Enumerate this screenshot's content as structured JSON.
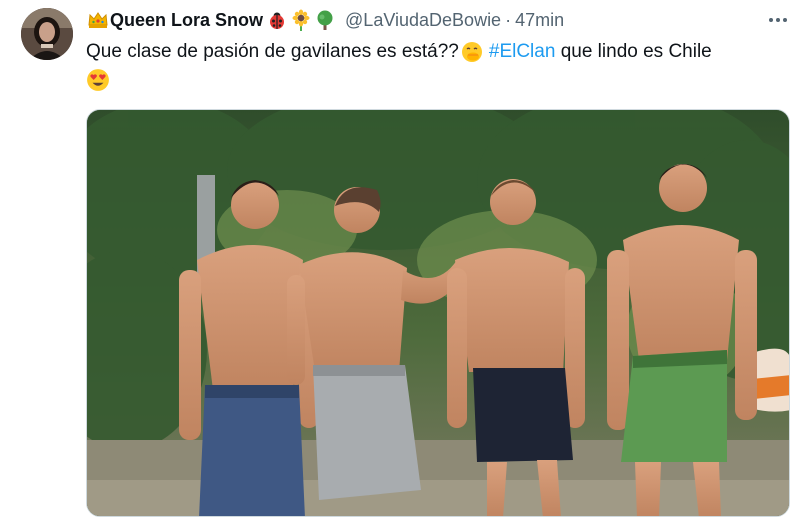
{
  "tweet": {
    "display_name": "Queen Lora Snow",
    "name_emojis_before": [
      "crown-emoji"
    ],
    "name_emojis_after": [
      "ladybug-emoji",
      "sunflower-emoji",
      "tree-emoji"
    ],
    "handle": "@LaViudaDeBowie",
    "separator": "·",
    "time": "47min",
    "more_icon": "ellipsis-icon",
    "text_before": "Que clase de pasión de gavilanes es está??",
    "emoji_mid": "hand-over-mouth-emoji",
    "hashtag": "#ElClan",
    "text_after": " que lindo es Chile",
    "emoji_end": "heart-eyes-emoji"
  },
  "media": {
    "kind": "photo",
    "description_icon": "photo-of-four-men-icon"
  },
  "colors": {
    "text": "#0f1419",
    "muted": "#536471",
    "link": "#1d9bf0",
    "border": "#cfd9de"
  }
}
